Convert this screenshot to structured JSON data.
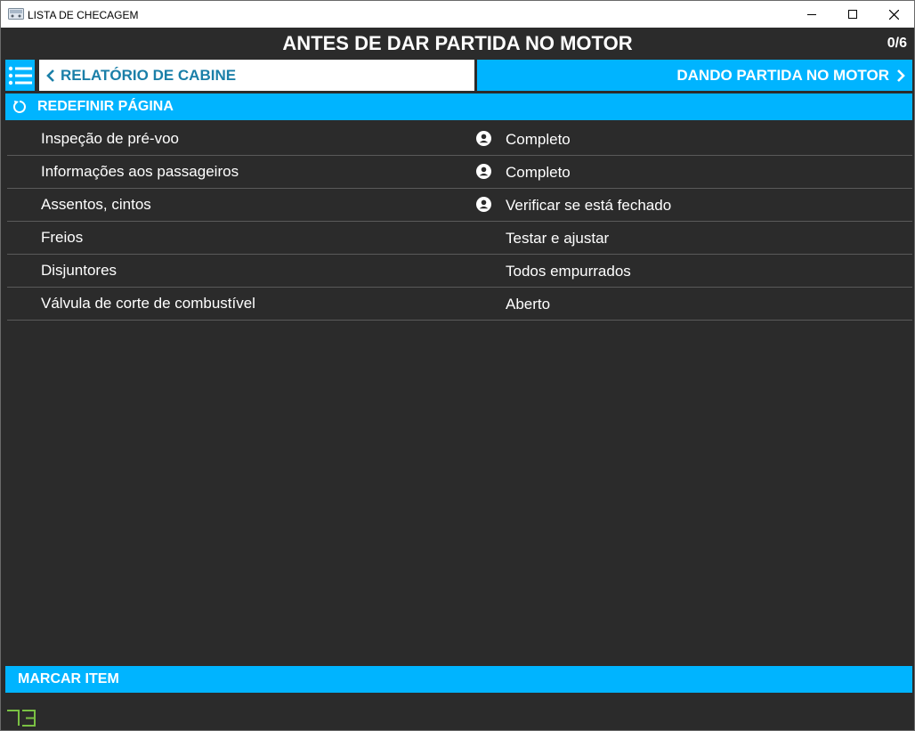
{
  "window": {
    "title": "LISTA DE CHECAGEM"
  },
  "header": {
    "title": "ANTES DE DAR PARTIDA NO MOTOR",
    "counter": "0/6"
  },
  "nav": {
    "prev_label": "RELATÓRIO DE CABINE",
    "next_label": "DANDO PARTIDA NO MOTOR"
  },
  "reset_label": "REDEFINIR PÁGINA",
  "items": [
    {
      "label": "Inspeção de pré-voo",
      "value": "Completo",
      "icon": "person-icon"
    },
    {
      "label": "Informações aos passageiros",
      "value": "Completo",
      "icon": "person-icon"
    },
    {
      "label": "Assentos, cintos",
      "value": "Verificar se está fechado",
      "icon": "person-icon"
    },
    {
      "label": "Freios",
      "value": "Testar e ajustar"
    },
    {
      "label": "Disjuntores",
      "value": "Todos empurrados"
    },
    {
      "label": "Válvula de corte de combustível",
      "value": "Aberto"
    }
  ],
  "mark_label": "MARCAR ITEM",
  "colors": {
    "accent": "#00b4ff",
    "background": "#2b2b2b",
    "prev_text": "#1a7fa8",
    "logo": "#7ac143"
  }
}
